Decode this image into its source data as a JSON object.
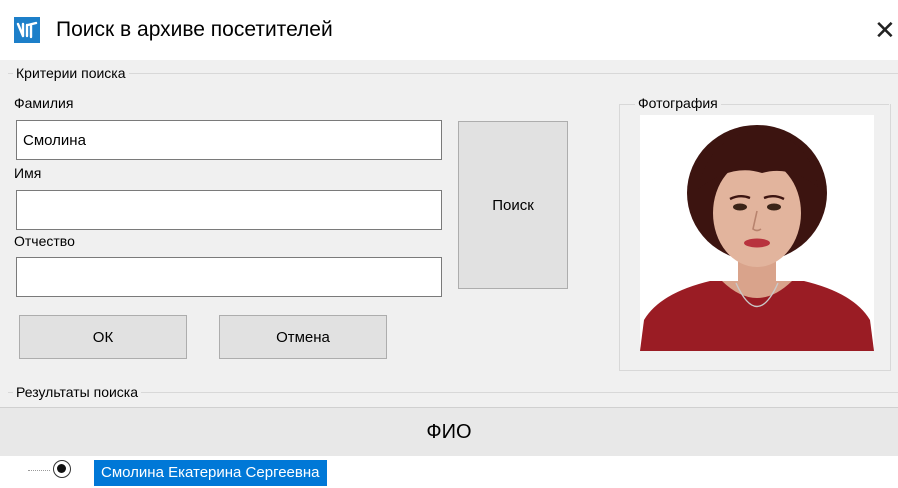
{
  "window": {
    "title": "Поиск в архиве посетителей",
    "icon": "app-logo-icon",
    "close_icon": "close-icon",
    "close_glyph": "✕"
  },
  "criteria": {
    "legend": "Критерии поиска",
    "surname_label": "Фамилия",
    "surname_value": "Смолина",
    "name_label": "Имя",
    "name_value": "",
    "patronymic_label": "Отчество",
    "patronymic_value": "",
    "search_button": "Поиск",
    "ok_button": "ОК",
    "cancel_button": "Отмена"
  },
  "photo": {
    "legend": "Фотография"
  },
  "results": {
    "legend": "Результаты поиска",
    "columns": [
      "ФИО"
    ],
    "rows": [
      {
        "fio": "Смолина Екатерина Сергеевна",
        "selected": true
      }
    ]
  },
  "colors": {
    "accent": "#0078d7",
    "window_bg": "#f0f0f0",
    "icon_blue": "#1d7fc9"
  }
}
